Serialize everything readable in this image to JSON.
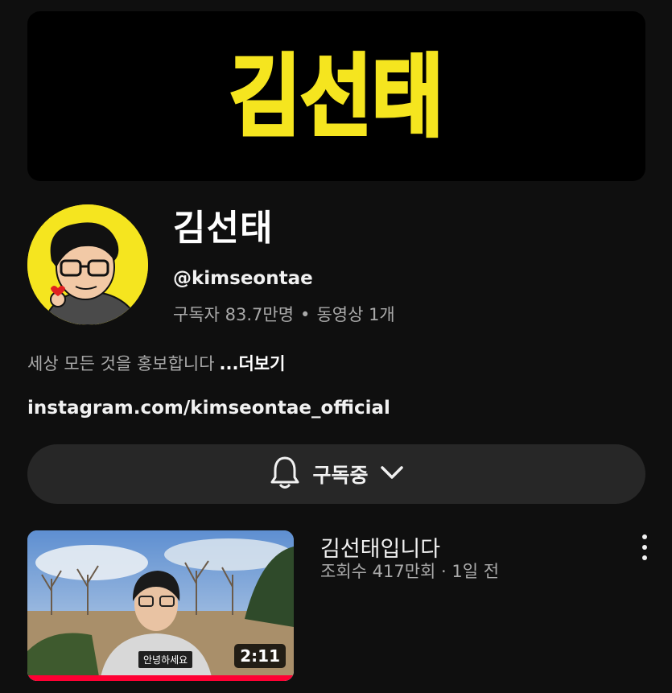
{
  "banner": {
    "logo_text": "김선태",
    "accent_color": "#f5e51f"
  },
  "channel": {
    "name": "김선태",
    "handle": "@kimseontae",
    "subscribers": "구독자 83.7만명",
    "separator": "•",
    "videos": "동영상 1개",
    "description": "세상 모든 것을 홍보합니다",
    "more_label": "...더보기",
    "link": "instagram.com/kimseontae_official"
  },
  "subscribe_button": {
    "label": "구독중",
    "icon": "bell-icon",
    "chevron": "chevron-down-icon"
  },
  "videos": [
    {
      "title": "김선태입니다",
      "meta": "조회수 417만회 · 1일 전",
      "duration": "2:11",
      "caption": "안녕하세요",
      "watched_fraction": 1.0
    }
  ],
  "colors": {
    "background": "#0f0f0f",
    "button_bg": "#272727",
    "progress_red": "#ff0033",
    "secondary_text": "#aaaaaa"
  }
}
